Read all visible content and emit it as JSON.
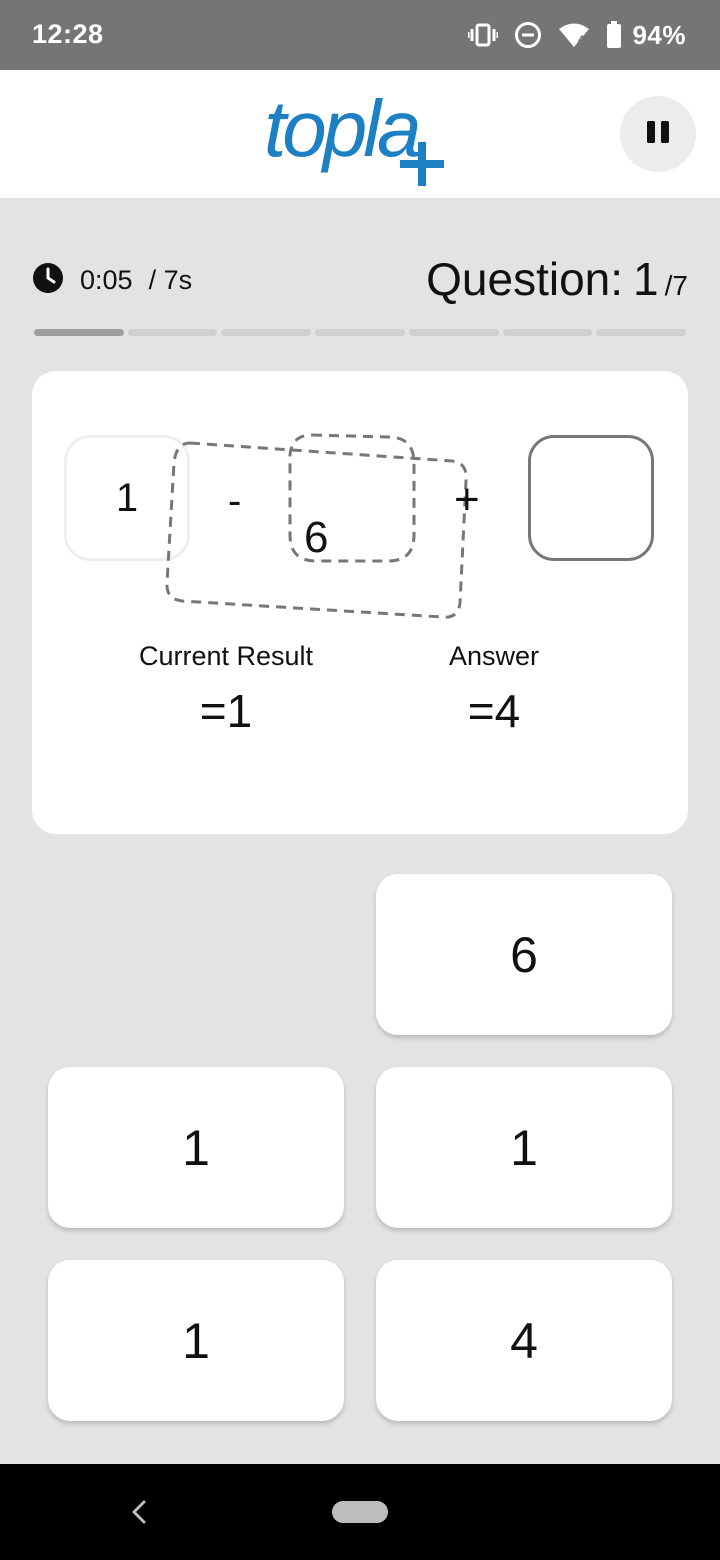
{
  "status_bar": {
    "time": "12:28",
    "battery_percent": "94%",
    "icons": [
      "vibrate-icon",
      "do-not-disturb-icon",
      "wifi-icon",
      "battery-icon"
    ]
  },
  "header": {
    "logo_text": "topla",
    "pause_icon": "pause-icon"
  },
  "timer": {
    "elapsed": "0:05",
    "limit": "/ 7s"
  },
  "question": {
    "label": "Question:",
    "current": "1",
    "total": "/7"
  },
  "progress": {
    "segments": 7,
    "active_segment": 1
  },
  "puzzle": {
    "slot_filled": "1",
    "operator_minus": "-",
    "floating_number": "6",
    "operator_plus": "+",
    "slot_empty": "",
    "current_result_label": "Current Result",
    "current_result_value": "=1",
    "answer_label": "Answer",
    "answer_value": "=4"
  },
  "tiles": {
    "r1c2": "6",
    "r2c1": "1",
    "r2c2": "1",
    "r3c1": "1",
    "r3c2": "4"
  },
  "colors": {
    "brand_blue": "#1d7fc4",
    "status_bar": "#757575",
    "background": "#e3e3e3"
  }
}
